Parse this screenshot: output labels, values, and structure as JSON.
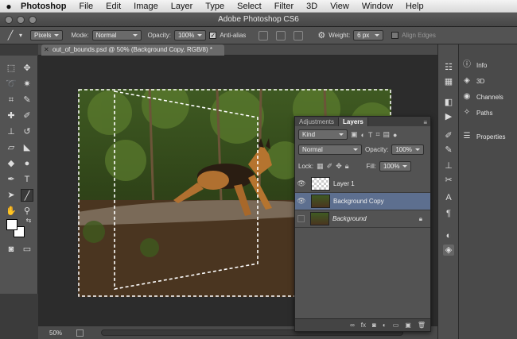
{
  "menubar": {
    "apple": "",
    "app": "Photoshop",
    "items": [
      "File",
      "Edit",
      "Image",
      "Layer",
      "Type",
      "Select",
      "Filter",
      "3D",
      "View",
      "Window",
      "Help"
    ]
  },
  "window": {
    "title": "Adobe Photoshop CS6"
  },
  "options": {
    "units": "Pixels",
    "mode_label": "Mode:",
    "mode_value": "Normal",
    "opacity_label": "Opacity:",
    "opacity_value": "100%",
    "antialias_label": "Anti-alias",
    "weight_label": "Weight:",
    "weight_value": "6 px",
    "align_edges_label": "Align Edges"
  },
  "document": {
    "tab_title": "out_of_bounds.psd @ 50% (Background Copy, RGB/8) *",
    "zoom": "50%"
  },
  "layers_panel": {
    "tabs": [
      "Adjustments",
      "Layers"
    ],
    "active_tab": "Layers",
    "filter_value": "Kind",
    "blend_mode": "Normal",
    "opacity_label": "Opacity:",
    "opacity_value": "100%",
    "lock_label": "Lock:",
    "fill_label": "Fill:",
    "fill_value": "100%",
    "layers": [
      {
        "name": "Layer 1",
        "visible": true,
        "selected": false
      },
      {
        "name": "Background Copy",
        "visible": true,
        "selected": true
      },
      {
        "name": "Background",
        "visible": false,
        "selected": false,
        "locked": true
      }
    ]
  },
  "right_panel": {
    "items": [
      {
        "label": "Info",
        "icon": "info-icon"
      },
      {
        "label": "3D",
        "icon": "cube-icon"
      },
      {
        "label": "Channels",
        "icon": "channels-icon"
      },
      {
        "label": "Paths",
        "icon": "paths-icon"
      },
      {
        "label": "Properties",
        "icon": "properties-icon"
      }
    ]
  },
  "colors": {
    "selection_layer": "#5d6f8f",
    "panel_bg": "#535353",
    "canvas_bg": "#2c2c2c"
  }
}
